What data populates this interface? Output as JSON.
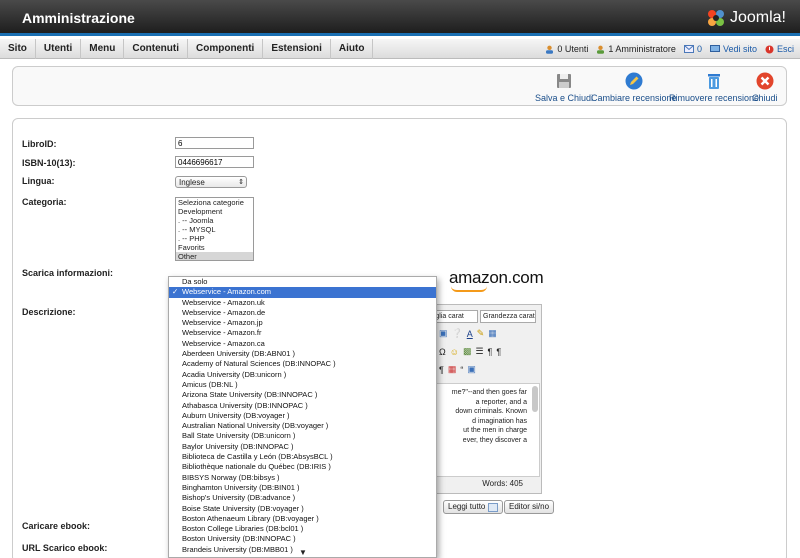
{
  "app": {
    "title": "Amministrazione",
    "logo_text": "Joomla!"
  },
  "menu": [
    "Sito",
    "Utenti",
    "Menu",
    "Contenuti",
    "Componenti",
    "Estensioni",
    "Aiuto"
  ],
  "status": {
    "users": "0 Utenti",
    "admins": "1 Amministratore",
    "messages": "0",
    "view_site": "Vedi sito",
    "logout": "Esci"
  },
  "toolbar": {
    "save_close": "Salva e Chiudi",
    "change_review": "Cambiare recensione",
    "remove_review": "Rimuovere recensione",
    "close": "Chiudi"
  },
  "form": {
    "book_id_label": "LibroID:",
    "book_id_value": "6",
    "isbn_label": "ISBN-10(13):",
    "isbn_value": "0446696617",
    "language_label": "Lingua:",
    "language_value": "Inglese",
    "category_label": "Categoria:",
    "categories": [
      "Seleziona categorie",
      "Development",
      ". -- Joomla",
      ". -- MYSQL",
      ". -- PHP",
      "Favorits",
      "Other"
    ],
    "download_info_label": "Scarica informazioni:",
    "description_label": "Descrizione:",
    "upload_ebook_label": "Caricare ebook:",
    "url_ebook_label": "URL Scarico ebook:"
  },
  "amazon_logo": "amazon.com",
  "editor": {
    "font_family": "miglia carat",
    "font_size": "Grandezza carat",
    "text_lines": [
      "me?\"--and then goes far",
      "a reporter, and a",
      "down criminals. Known",
      "d imagination has",
      "ut the men in charge",
      "ever, they discover a"
    ],
    "word_count": "Words: 405"
  },
  "buttons": {
    "read_all": "Leggi tutto",
    "editor_toggle": "Editor si/no"
  },
  "dropdown": {
    "selected_index": 1,
    "items": [
      "Da solo",
      "Webservice - Amazon.com",
      "Webservice - Amazon.uk",
      "Webservice - Amazon.de",
      "Webservice - Amazon.jp",
      "Webservice - Amazon.fr",
      "Webservice - Amazon.ca",
      "Aberdeen University (DB:ABN01 )",
      "Academy of Natural Sciences (DB:INNOPAC )",
      "Acadia University (DB:unicorn )",
      "Amicus (DB:NL )",
      "Arizona State University (DB:INNOPAC )",
      "Athabasca University (DB:INNOPAC )",
      "Auburn University (DB:voyager )",
      "Australian National University (DB:voyager )",
      "Ball State University (DB:unicorn )",
      "Baylor University (DB:INNOPAC )",
      "Biblioteca de Castilla y León (DB:AbsysBCL )",
      "Bibliothèque nationale du Québec (DB:IRIS )",
      "BIBSYS Norway (DB:bibsys )",
      "Binghamton University (DB:BIN01 )",
      "Bishop's University (DB:advance )",
      "Boise State University (DB:voyager )",
      "Boston Athenaeum Library (DB:voyager )",
      "Boston College Libraries (DB:bcl01 )",
      "Boston University (DB:INNOPAC )",
      "Brandeis University (DB:MBB01 )"
    ]
  }
}
